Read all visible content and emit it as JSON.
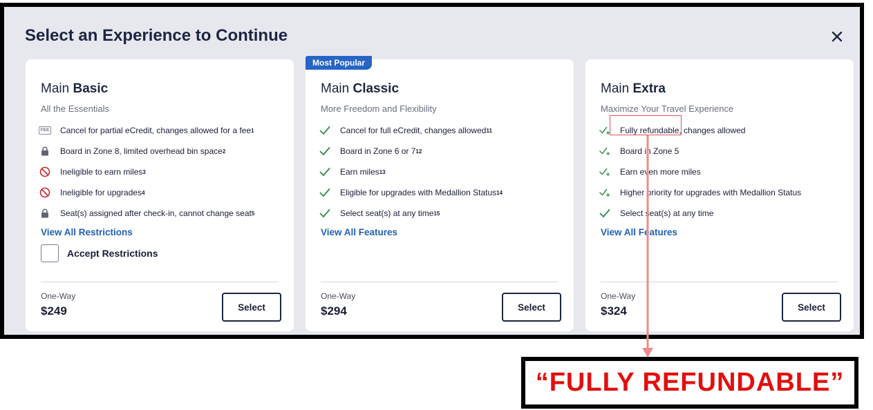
{
  "modal": {
    "title": "Select an Experience to Continue"
  },
  "cards": [
    {
      "title_prefix": "Main",
      "title_bold": "Basic",
      "subtitle": "All the Essentials",
      "features": [
        {
          "icon": "fee-icon",
          "fee_label": "FEE",
          "text": "Cancel for partial eCredit, changes allowed for a fee",
          "sup": "1"
        },
        {
          "icon": "lock-icon",
          "text": "Board in Zone 8, limited overhead bin space",
          "sup": "2"
        },
        {
          "icon": "no-icon",
          "text": "Ineligible to earn miles",
          "sup": "3"
        },
        {
          "icon": "no-icon",
          "text": "Ineligible for upgrades",
          "sup": "4"
        },
        {
          "icon": "lock-icon",
          "text": "Seat(s) assigned after check-in, cannot change seat",
          "sup": "5"
        }
      ],
      "link": "View All Restrictions",
      "accept_label": "Accept Restrictions",
      "price_label": "One-Way",
      "price": "$249",
      "select": "Select"
    },
    {
      "badge": "Most Popular",
      "title_prefix": "Main",
      "title_bold": "Classic",
      "subtitle": "More Freedom and Flexibility",
      "features": [
        {
          "icon": "check-icon",
          "text": "Cancel for full eCredit, changes allowed",
          "sup": "11"
        },
        {
          "icon": "check-icon",
          "text": "Board in Zone 6 or 7",
          "sup": "12"
        },
        {
          "icon": "check-icon",
          "text": "Earn miles",
          "sup": "13"
        },
        {
          "icon": "check-icon",
          "text": "Eligible for upgrades with Medallion Status",
          "sup": "14"
        },
        {
          "icon": "check-icon",
          "text": "Select seat(s) at any time",
          "sup": "15"
        }
      ],
      "link": "View All Features",
      "price_label": "One-Way",
      "price": "$294",
      "select": "Select"
    },
    {
      "title_prefix": "Main",
      "title_bold": "Extra",
      "subtitle": "Maximize Your Travel Experience",
      "features": [
        {
          "icon": "check-plus-icon",
          "text": "Fully refundable, changes allowed",
          "sup": ""
        },
        {
          "icon": "check-plus-icon",
          "text": "Board in Zone 5",
          "sup": ""
        },
        {
          "icon": "check-plus-icon",
          "text": "Earn even more miles",
          "sup": ""
        },
        {
          "icon": "check-plus-icon",
          "text": "Higher priority for upgrades with Medallion Status",
          "sup": ""
        },
        {
          "icon": "check-icon",
          "text": "Select seat(s) at any time",
          "sup": ""
        }
      ],
      "link": "View All Features",
      "price_label": "One-Way",
      "price": "$324",
      "select": "Select"
    }
  ],
  "callout": {
    "text": "“FULLY REFUNDABLE”"
  },
  "colors": {
    "accent": "#2261b6",
    "check": "#2e8b4a",
    "annotation": "#e20e0e",
    "badge": "#2764c6"
  }
}
